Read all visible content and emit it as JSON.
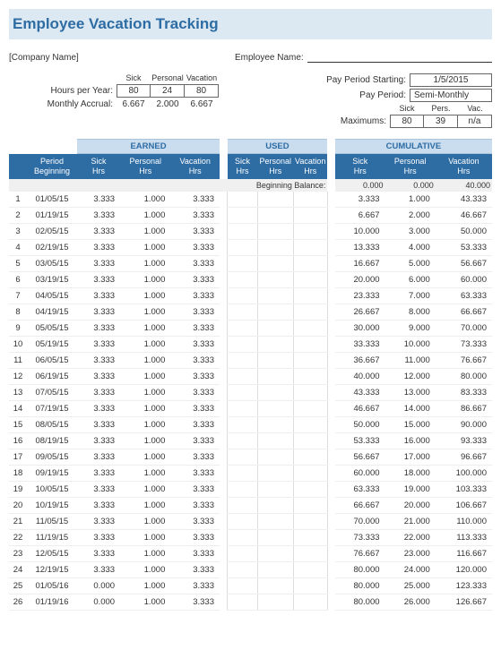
{
  "title": "Employee Vacation Tracking",
  "company": "[Company Name]",
  "employee_label": "Employee Name:",
  "hours_per_year_label": "Hours per Year:",
  "monthly_accrual_label": "Monthly Accrual:",
  "pay_period_start_label": "Pay Period Starting:",
  "pay_period_label": "Pay Period:",
  "maximums_label": "Maximums:",
  "hdr": {
    "sick": "Sick",
    "personal": "Personal",
    "vacation": "Vacation",
    "pers": "Pers.",
    "vac": "Vac."
  },
  "hours_per_year": {
    "sick": "80",
    "personal": "24",
    "vacation": "80"
  },
  "monthly_accrual": {
    "sick": "6.667",
    "personal": "2.000",
    "vacation": "6.667"
  },
  "pay_period_start": "1/5/2015",
  "pay_period": "Semi-Monthly",
  "maximums": {
    "sick": "80",
    "personal": "39",
    "vacation": "n/a"
  },
  "groups": {
    "earned": "EARNED",
    "used": "USED",
    "cumulative": "CUMULATIVE"
  },
  "cols": {
    "period": "Period Beginning",
    "sick": "Sick Hrs",
    "personal": "Personal Hrs",
    "vacation": "Vacation Hrs"
  },
  "beg_balance_label": "Beginning Balance:",
  "beg_balance": {
    "sick": "0.000",
    "personal": "0.000",
    "vacation": "40.000"
  },
  "rows": [
    {
      "n": "1",
      "d": "01/05/15",
      "es": "3.333",
      "ep": "1.000",
      "ev": "3.333",
      "cs": "3.333",
      "cp": "1.000",
      "cv": "43.333"
    },
    {
      "n": "2",
      "d": "01/19/15",
      "es": "3.333",
      "ep": "1.000",
      "ev": "3.333",
      "cs": "6.667",
      "cp": "2.000",
      "cv": "46.667"
    },
    {
      "n": "3",
      "d": "02/05/15",
      "es": "3.333",
      "ep": "1.000",
      "ev": "3.333",
      "cs": "10.000",
      "cp": "3.000",
      "cv": "50.000"
    },
    {
      "n": "4",
      "d": "02/19/15",
      "es": "3.333",
      "ep": "1.000",
      "ev": "3.333",
      "cs": "13.333",
      "cp": "4.000",
      "cv": "53.333"
    },
    {
      "n": "5",
      "d": "03/05/15",
      "es": "3.333",
      "ep": "1.000",
      "ev": "3.333",
      "cs": "16.667",
      "cp": "5.000",
      "cv": "56.667"
    },
    {
      "n": "6",
      "d": "03/19/15",
      "es": "3.333",
      "ep": "1.000",
      "ev": "3.333",
      "cs": "20.000",
      "cp": "6.000",
      "cv": "60.000"
    },
    {
      "n": "7",
      "d": "04/05/15",
      "es": "3.333",
      "ep": "1.000",
      "ev": "3.333",
      "cs": "23.333",
      "cp": "7.000",
      "cv": "63.333"
    },
    {
      "n": "8",
      "d": "04/19/15",
      "es": "3.333",
      "ep": "1.000",
      "ev": "3.333",
      "cs": "26.667",
      "cp": "8.000",
      "cv": "66.667"
    },
    {
      "n": "9",
      "d": "05/05/15",
      "es": "3.333",
      "ep": "1.000",
      "ev": "3.333",
      "cs": "30.000",
      "cp": "9.000",
      "cv": "70.000"
    },
    {
      "n": "10",
      "d": "05/19/15",
      "es": "3.333",
      "ep": "1.000",
      "ev": "3.333",
      "cs": "33.333",
      "cp": "10.000",
      "cv": "73.333"
    },
    {
      "n": "11",
      "d": "06/05/15",
      "es": "3.333",
      "ep": "1.000",
      "ev": "3.333",
      "cs": "36.667",
      "cp": "11.000",
      "cv": "76.667"
    },
    {
      "n": "12",
      "d": "06/19/15",
      "es": "3.333",
      "ep": "1.000",
      "ev": "3.333",
      "cs": "40.000",
      "cp": "12.000",
      "cv": "80.000"
    },
    {
      "n": "13",
      "d": "07/05/15",
      "es": "3.333",
      "ep": "1.000",
      "ev": "3.333",
      "cs": "43.333",
      "cp": "13.000",
      "cv": "83.333"
    },
    {
      "n": "14",
      "d": "07/19/15",
      "es": "3.333",
      "ep": "1.000",
      "ev": "3.333",
      "cs": "46.667",
      "cp": "14.000",
      "cv": "86.667"
    },
    {
      "n": "15",
      "d": "08/05/15",
      "es": "3.333",
      "ep": "1.000",
      "ev": "3.333",
      "cs": "50.000",
      "cp": "15.000",
      "cv": "90.000"
    },
    {
      "n": "16",
      "d": "08/19/15",
      "es": "3.333",
      "ep": "1.000",
      "ev": "3.333",
      "cs": "53.333",
      "cp": "16.000",
      "cv": "93.333"
    },
    {
      "n": "17",
      "d": "09/05/15",
      "es": "3.333",
      "ep": "1.000",
      "ev": "3.333",
      "cs": "56.667",
      "cp": "17.000",
      "cv": "96.667"
    },
    {
      "n": "18",
      "d": "09/19/15",
      "es": "3.333",
      "ep": "1.000",
      "ev": "3.333",
      "cs": "60.000",
      "cp": "18.000",
      "cv": "100.000"
    },
    {
      "n": "19",
      "d": "10/05/15",
      "es": "3.333",
      "ep": "1.000",
      "ev": "3.333",
      "cs": "63.333",
      "cp": "19.000",
      "cv": "103.333"
    },
    {
      "n": "20",
      "d": "10/19/15",
      "es": "3.333",
      "ep": "1.000",
      "ev": "3.333",
      "cs": "66.667",
      "cp": "20.000",
      "cv": "106.667"
    },
    {
      "n": "21",
      "d": "11/05/15",
      "es": "3.333",
      "ep": "1.000",
      "ev": "3.333",
      "cs": "70.000",
      "cp": "21.000",
      "cv": "110.000"
    },
    {
      "n": "22",
      "d": "11/19/15",
      "es": "3.333",
      "ep": "1.000",
      "ev": "3.333",
      "cs": "73.333",
      "cp": "22.000",
      "cv": "113.333"
    },
    {
      "n": "23",
      "d": "12/05/15",
      "es": "3.333",
      "ep": "1.000",
      "ev": "3.333",
      "cs": "76.667",
      "cp": "23.000",
      "cv": "116.667"
    },
    {
      "n": "24",
      "d": "12/19/15",
      "es": "3.333",
      "ep": "1.000",
      "ev": "3.333",
      "cs": "80.000",
      "cp": "24.000",
      "cv": "120.000"
    },
    {
      "n": "25",
      "d": "01/05/16",
      "es": "0.000",
      "ep": "1.000",
      "ev": "3.333",
      "cs": "80.000",
      "cp": "25.000",
      "cv": "123.333"
    },
    {
      "n": "26",
      "d": "01/19/16",
      "es": "0.000",
      "ep": "1.000",
      "ev": "3.333",
      "cs": "80.000",
      "cp": "26.000",
      "cv": "126.667"
    }
  ]
}
